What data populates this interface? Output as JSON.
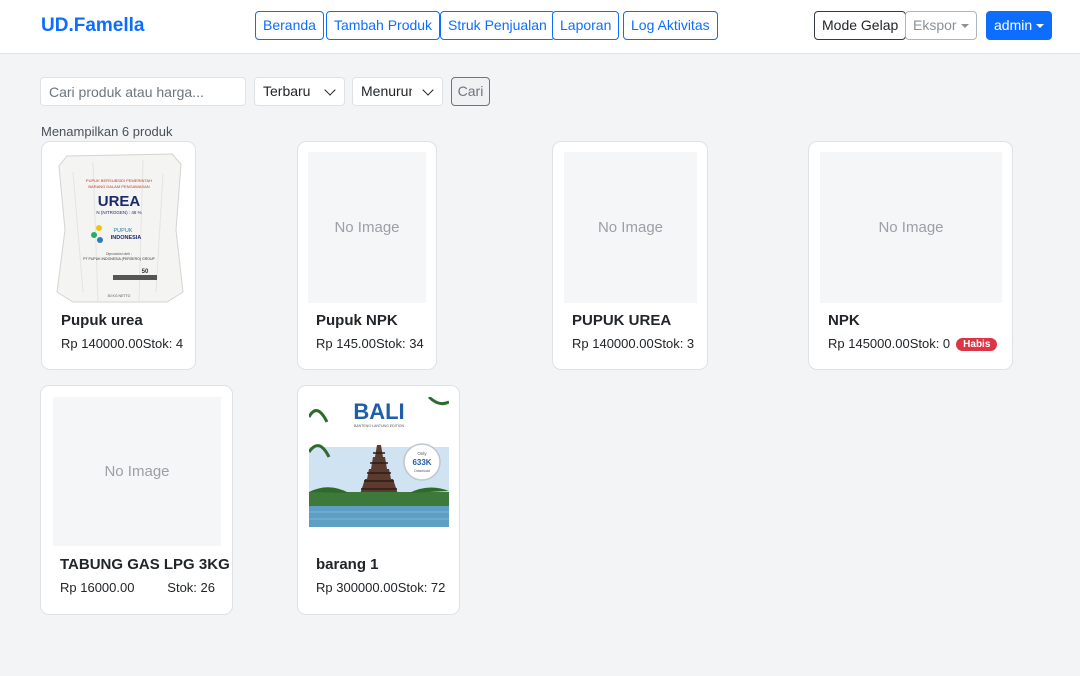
{
  "brand": "UD.Famella",
  "nav": {
    "beranda": "Beranda",
    "tambah_produk": "Tambah Produk",
    "struk_penjualan": "Struk Penjualan",
    "laporan": "Laporan",
    "log_aktivitas": "Log Aktivitas"
  },
  "actions": {
    "dark_mode": "Mode Gelap",
    "export": "Ekspor",
    "user": "admin"
  },
  "filters": {
    "search_placeholder": "Cari produk atau harga...",
    "sort_by": "Terbaru",
    "order": "Menurun",
    "search_button": "Cari"
  },
  "result_count": "Menampilkan 6 produk",
  "no_image": "No Image",
  "products": [
    {
      "name": "Pupuk urea",
      "price": "Rp 140000.00",
      "stock": "Stok: 4",
      "image": "urea-sack"
    },
    {
      "name": "Pupuk NPK",
      "price": "Rp 145.00",
      "stock": "Stok: 34",
      "image": "none"
    },
    {
      "name": "PUPUK UREA",
      "price": "Rp 140000.00",
      "stock": "Stok: 3",
      "image": "none"
    },
    {
      "name": "NPK",
      "price": "Rp 145000.00",
      "stock": "Stok: 0",
      "badge": "Habis",
      "image": "none"
    },
    {
      "name": "TABUNG GAS LPG 3KG",
      "price": "Rp 16000.00",
      "stock": "Stok: 26",
      "image": "none"
    },
    {
      "name": "barang 1",
      "price": "Rp 300000.00",
      "stock": "Stok: 72",
      "image": "bali-cover"
    }
  ],
  "urea_image_text": {
    "line1": "PUPUK BERSUBSIDI PEMERINTAH",
    "line2": "BARANG DALAM PENGAWASAN",
    "title": "UREA",
    "spec": "N (NITROGEN) : 46 %",
    "brand1": "PUPUK",
    "brand2": "INDONESIA",
    "producer1": "Diproduksi oleh :",
    "producer2": "PT PUPUK INDONESIA (PERSERO) GROUP",
    "weight": "50",
    "footer": "50 KG NETTO"
  },
  "bali_image_text": {
    "title": "BALI",
    "subtitle": "BANTENG·LANTUNG EDITION",
    "badge_top": "Only",
    "badge_value": "633K",
    "badge_bottom": "Download"
  },
  "colors": {
    "primary": "#0d6efd",
    "danger": "#dc3545",
    "background": "#f3f4f6"
  }
}
